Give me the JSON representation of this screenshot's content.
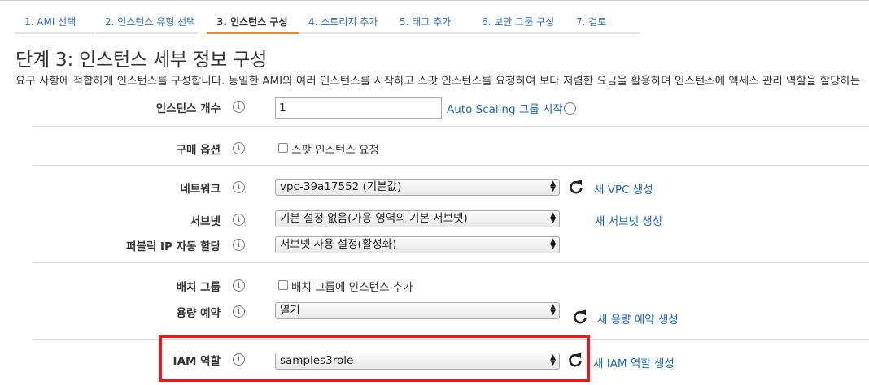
{
  "tabs": [
    {
      "label": "1. AMI 선택"
    },
    {
      "label": "2. 인스턴스 유형 선택"
    },
    {
      "label": "3. 인스턴스 구성"
    },
    {
      "label": "4. 스토리지 추가"
    },
    {
      "label": "5. 태그 추가"
    },
    {
      "label": "6. 보안 그룹 구성"
    },
    {
      "label": "7. 검토"
    }
  ],
  "page": {
    "title": "단계 3: 인스턴스 세부 정보 구성",
    "description": "요구 사항에 적합하게 인스턴스를 구성합니다. 동일한 AMI의 여러 인스턴스를 시작하고 스팟 인스턴스를 요청하여 보다 저렴한 요금을 활용하며 인스턴스에 액세스 관리 역할을 할당하는"
  },
  "form": {
    "instance_count": {
      "label": "인스턴스 개수",
      "value": "1",
      "link": "Auto Scaling 그룹 시작"
    },
    "purchase_option": {
      "label": "구매 옵션",
      "checkbox_label": "스팟 인스턴스 요청"
    },
    "network": {
      "label": "네트워크",
      "value": "vpc-39a17552 (기본값)",
      "link": "새 VPC 생성"
    },
    "subnet": {
      "label": "서브넷",
      "value": "기본 설정 없음(가용 영역의 기본 서브넷)",
      "link": "새 서브넷 생성"
    },
    "public_ip": {
      "label": "퍼블릭 IP 자동 할당",
      "value": "서브넷 사용 설정(활성화)"
    },
    "placement_group": {
      "label": "배치 그룹",
      "checkbox_label": "배치 그룹에 인스턴스 추가"
    },
    "capacity_reservation": {
      "label": "용량 예약",
      "value": "열기",
      "link": "새 용량 예약 생성"
    },
    "iam_role": {
      "label": "IAM 역할",
      "value": "samples3role",
      "link": "새 IAM 역할 생성"
    }
  },
  "icons": {
    "info": "info-icon",
    "refresh": "refresh-icon",
    "select_arrows": "select-arrows-icon"
  },
  "colors": {
    "link": "#1a68b5",
    "active_tab_underline": "#e48a2a",
    "highlight_border": "#e8191c"
  }
}
